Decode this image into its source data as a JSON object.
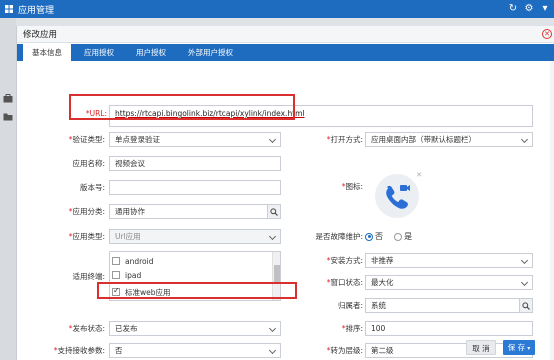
{
  "window": {
    "title": "应用管理"
  },
  "dialog": {
    "title": "修改应用"
  },
  "tabs": [
    {
      "label": "基本信息"
    },
    {
      "label": "应用授权"
    },
    {
      "label": "用户授权"
    },
    {
      "label": "外部用户授权"
    }
  ],
  "form": {
    "url": {
      "label": "*URL:",
      "value": "https://rtcapi.bingolink.biz/rtcapi/xylink/index.html"
    },
    "auth_type": {
      "label": "验证类型:",
      "value": "单点登录验证"
    },
    "open_mode": {
      "label": "打开方式:",
      "value": "应用桌面内部（带默认标题栏）"
    },
    "app_name": {
      "label": "应用名称:",
      "value": "视频会议"
    },
    "version": {
      "label": "版本号:",
      "value": ""
    },
    "icon": {
      "label": "图标:"
    },
    "category": {
      "label": "应用分类:",
      "value": "通用协作"
    },
    "app_type": {
      "label": "应用类型:",
      "value": "Url应用"
    },
    "maintenance": {
      "label": "是否故障维护:",
      "options": [
        "否",
        "是"
      ],
      "selected": "否"
    },
    "terminals": {
      "label": "适用终端:",
      "items": [
        {
          "label": "android",
          "checked": false
        },
        {
          "label": "ipad",
          "checked": false
        },
        {
          "label": "标准web应用",
          "checked": true
        }
      ]
    },
    "install_mode": {
      "label": "安装方式:",
      "value": "非推荐"
    },
    "window_state": {
      "label": "窗口状态:",
      "value": "最大化"
    },
    "owner": {
      "label": "归属者:",
      "value": "系统"
    },
    "publish_state": {
      "label": "发布状态:",
      "value": "已发布"
    },
    "sort": {
      "label": "排序:",
      "value": "100"
    },
    "support_params": {
      "label": "支持接收参数:",
      "value": "否"
    },
    "level": {
      "label": "转为层级:",
      "value": "第二级"
    }
  },
  "buttons": {
    "cancel": "取 消",
    "save": "保 存"
  },
  "colors": {
    "brand": "#1e6cc0",
    "highlight": "#d9302f",
    "icon_bg": "#2b6fd6"
  }
}
